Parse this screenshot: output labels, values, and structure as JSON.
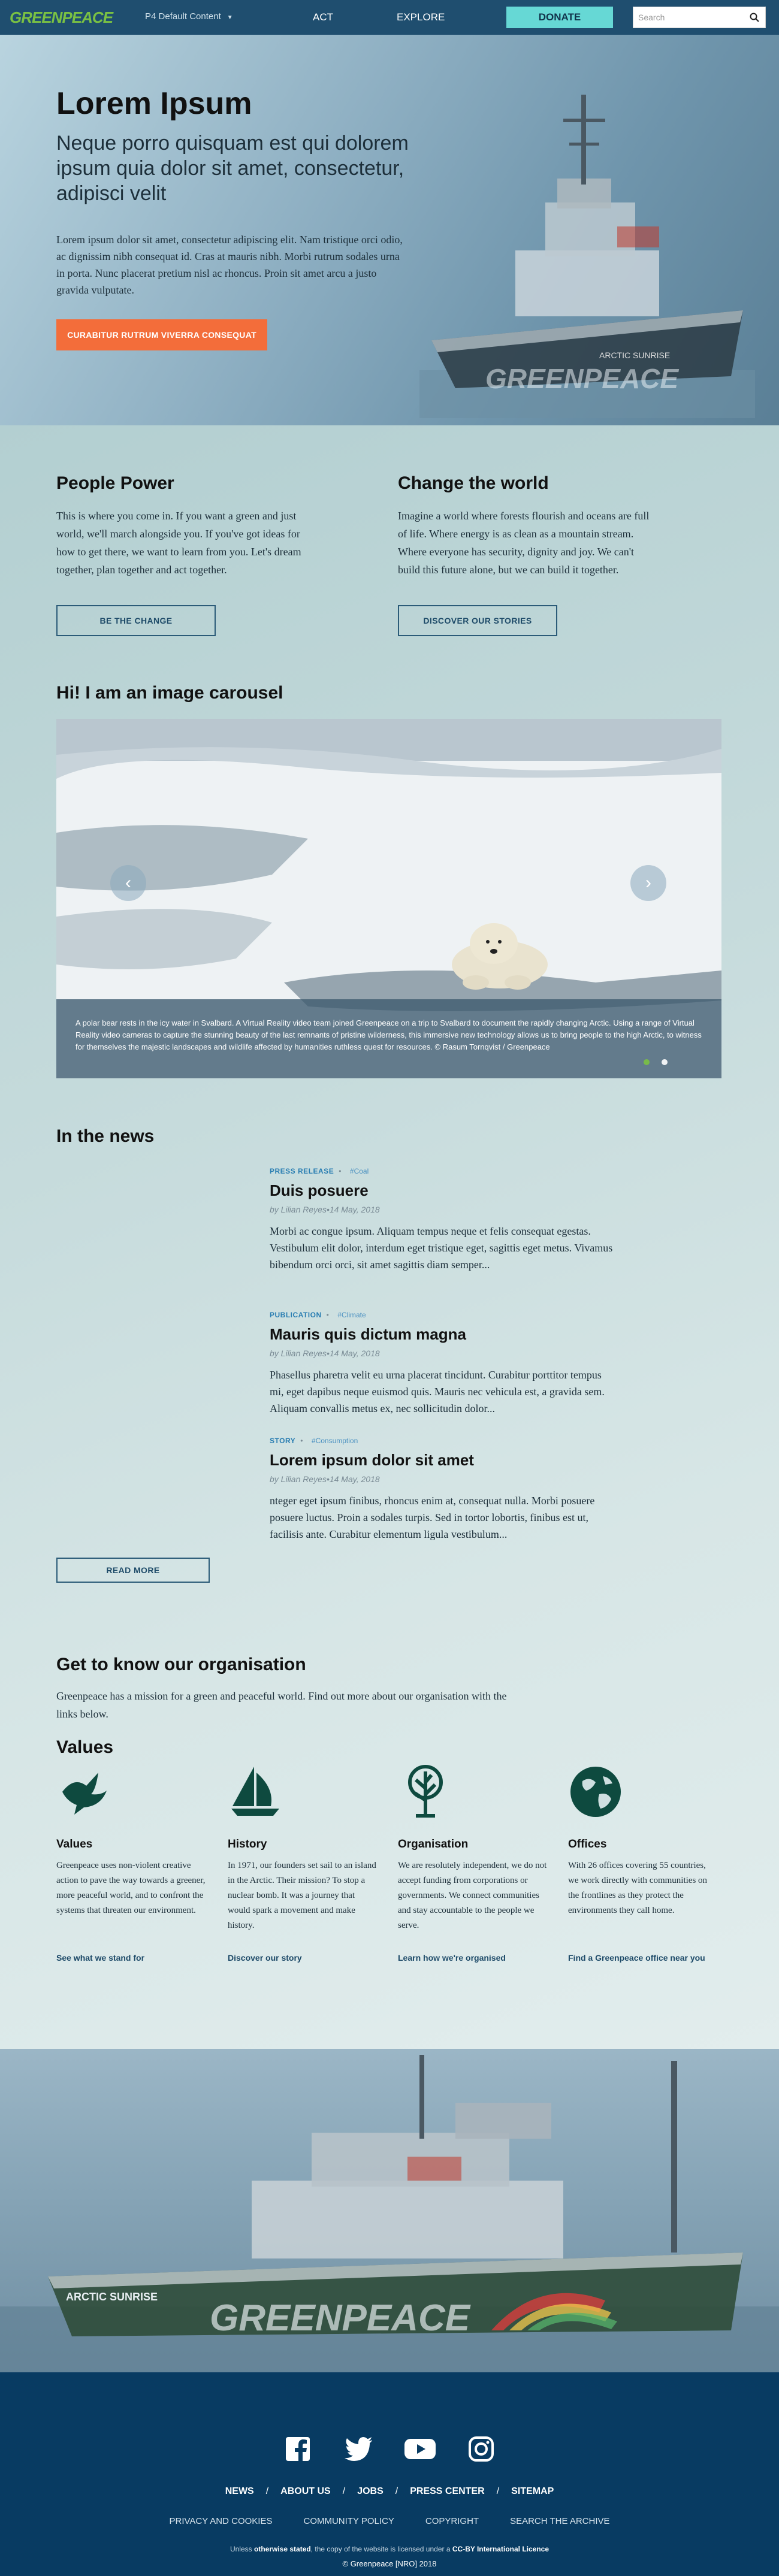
{
  "nav": {
    "logo": "GREENPEACE",
    "dropdown_label": "P4 Default Content",
    "links": [
      "ACT",
      "EXPLORE"
    ],
    "donate": "DONATE",
    "search_placeholder": "Search"
  },
  "hero": {
    "title": "Lorem Ipsum",
    "subtitle": "Neque porro quisquam est qui dolorem ipsum quia dolor sit amet, consectetur, adipisci velit",
    "text": "Lorem ipsum dolor sit amet, consectetur adipiscing elit. Nam tristique orci odio, ac dignissim nibh consequat id. Cras at mauris nibh. Morbi rutrum sodales urna in porta. Nunc placerat pretium nisl ac rhoncus. Proin sit amet arcu a justo gravida vulputate.",
    "button": "CURABITUR RUTRUM VIVERRA CONSEQUAT",
    "ship_name": "ARCTIC SUNRISE",
    "hull_text": "GREENPEACE"
  },
  "columns": [
    {
      "title": "People Power",
      "text": "This is where you come in. If you want a green and just world, we'll march alongside you. If you've got ideas for how to get there, we want to learn from you. Let's dream together, plan together and act together.",
      "button": "BE THE CHANGE"
    },
    {
      "title": "Change the world",
      "text": "Imagine a world where forests flourish and oceans are full of life. Where energy is as clean as a mountain stream. Where everyone has security, dignity and joy. We can't build this future alone, but we can build it together.",
      "button": "DISCOVER OUR STORIES"
    }
  ],
  "carousel": {
    "title": "Hi! I am an image carousel",
    "caption": "A polar bear rests in the icy water in Svalbard. A Virtual Reality video team joined Greenpeace on a trip to Svalbard to document the rapidly changing Arctic. Using a range of Virtual Reality video cameras to capture the stunning beauty of the last remnants of pristine wilderness, this immersive new technology allows us to bring people to the high Arctic, to witness for themselves the majestic landscapes and wildlife affected by humanities ruthless quest for resources. © Rasum Tornqvist / Greenpeace",
    "prev": "‹",
    "next": "›"
  },
  "news": {
    "title": "In the news",
    "items": [
      {
        "type": "PRESS RELEASE",
        "tag": "#Coal",
        "title": "Duis posuere",
        "author": "by Lilian Reyes",
        "date": "14 May, 2018",
        "text": "Morbi ac congue ipsum. Aliquam tempus neque et felis consequat egestas. Vestibulum elit dolor, interdum eget tristique eget, sagittis eget metus. Vivamus bibendum orci orci, sit amet sagittis diam semper..."
      },
      {
        "type": "PUBLICATION",
        "tag": "#Climate",
        "title": "Mauris quis dictum magna",
        "author": "by Lilian Reyes",
        "date": "14 May, 2018",
        "text": "Phasellus pharetra velit eu urna placerat tincidunt. Curabitur porttitor tempus mi, eget dapibus neque euismod quis. Mauris nec vehicula est, a gravida sem. Aliquam convallis metus ex, nec sollicitudin dolor..."
      },
      {
        "type": "STORY",
        "tag": "#Consumption",
        "title": "Lorem ipsum dolor sit amet",
        "author": "by Lilian Reyes",
        "date": "14 May, 2018",
        "text": "nteger eget ipsum finibus, rhoncus enim at, consequat nulla. Morbi posuere posuere luctus. Proin a sodales turpis. Sed in tortor lobortis, finibus est ut, facilisis ante. Curabitur elementum ligula vestibulum..."
      }
    ],
    "read_more": "READ MORE"
  },
  "org": {
    "title": "Get to know our organisation",
    "text": "Greenpeace has a mission for a green and peaceful world. Find out more about our organisation with the links below.",
    "values_title": "Values",
    "items": [
      {
        "icon": "dove-icon",
        "title": "Values",
        "text": "Greenpeace uses non-violent creative action to pave the way towards a greener, more peaceful world, and to confront the systems that threaten our environment.",
        "link": "See what we stand for"
      },
      {
        "icon": "sailboat-icon",
        "title": "History",
        "text": "In 1971, our founders set sail to an island in the Arctic. Their mission? To stop a nuclear bomb. It was a journey that would spark a movement and make history.",
        "link": "Discover our story"
      },
      {
        "icon": "tree-icon",
        "title": "Organisation",
        "text": "We are resolutely independent, we do not accept funding from corporations or governments. We connect communities and stay accountable to the people we serve.",
        "link": "Learn how we're organised"
      },
      {
        "icon": "globe-icon",
        "title": "Offices",
        "text": "With 26 offices covering 55 countries, we work directly with communities on the frontlines as they protect the environments they call home.",
        "link": "Find a Greenpeace office near you"
      }
    ]
  },
  "banner": {
    "ship_name": "ARCTIC SUNRISE",
    "hull_text": "GREENPEACE"
  },
  "footer": {
    "social": [
      "facebook-icon",
      "twitter-icon",
      "youtube-icon",
      "instagram-icon"
    ],
    "links": [
      "NEWS",
      "ABOUT US",
      "JOBS",
      "PRESS CENTER",
      "SITEMAP"
    ],
    "separator": "/",
    "links2": [
      "PRIVACY AND COOKIES",
      "COMMUNITY POLICY",
      "COPYRIGHT",
      "SEARCH THE ARCHIVE"
    ],
    "license_pre": "Unless",
    "license_bold1": "otherwise stated",
    "license_mid": ", the copy of the website is licensed under a",
    "license_bold2": "CC-BY International Licence",
    "copyright": "© Greenpeace [NRO] 2018"
  },
  "colors": {
    "nav_bg": "#1f4e6f",
    "donate": "#66d8d5",
    "cta": "#f36d3a",
    "footer_bg": "#083b62",
    "icon_green": "#0e4a3f",
    "brand_green": "#7ac143"
  }
}
